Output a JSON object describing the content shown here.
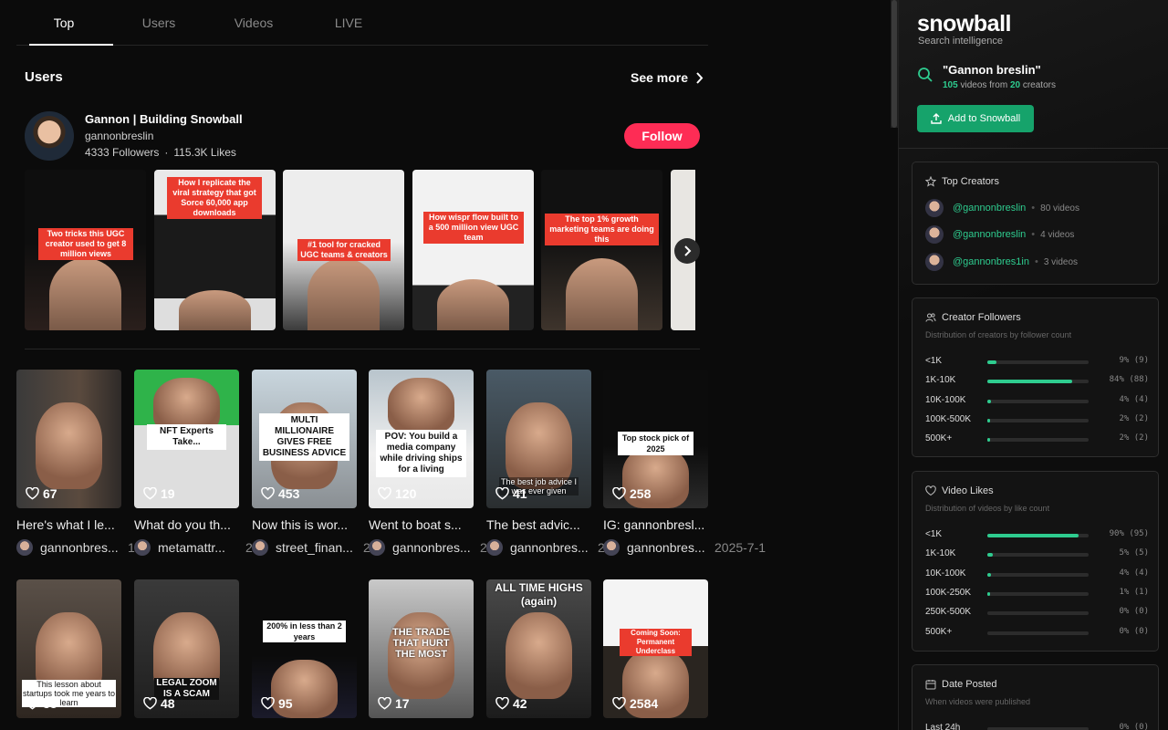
{
  "tabs": [
    "Top",
    "Users",
    "Videos",
    "LIVE"
  ],
  "users_section": {
    "title": "Users",
    "see_more": "See more",
    "user": {
      "name": "Gannon | Building Snowball",
      "handle": "gannonbreslin",
      "followers": "4333 Followers",
      "likes": "115.3K Likes",
      "follow": "Follow"
    },
    "thumb_captions": [
      "Two tricks this UGC creator used to get 8 million views",
      "How I replicate the viral strategy that got Sorce 60,000 app downloads",
      "#1 tool for cracked UGC teams & creators",
      "How wispr flow built to a 500 million view UGC team",
      "The top 1% growth marketing teams are doing this",
      ""
    ]
  },
  "videos_row1": [
    {
      "overlay": "",
      "likes": "67",
      "title": "Here's what I le...",
      "author": "gannonbres...",
      "date": "1"
    },
    {
      "overlay": "NFT Experts Take...",
      "likes": "19",
      "title": "What do you th...",
      "author": "metamattr...",
      "date": "2"
    },
    {
      "overlay": "MULTI MILLIONAIRE GIVES FREE BUSINESS ADVICE",
      "likes": "453",
      "title": "Now this is wor...",
      "author": "street_finan...",
      "date": "2"
    },
    {
      "overlay": "POV: You build a media company while driving ships for a living",
      "likes": "120",
      "title": "Went to boat s...",
      "author": "gannonbres...",
      "date": "2"
    },
    {
      "overlay": "The best job advice I was ever given",
      "likes": "41",
      "title": "The best advic...",
      "author": "gannonbres...",
      "date": "2"
    },
    {
      "overlay": "Top stock pick of 2025",
      "likes": "258",
      "title": "IG: gannonbresl...",
      "author": "gannonbres...",
      "date": "2025-7-1"
    }
  ],
  "videos_row2": [
    {
      "overlay": "This lesson about startups took me years to learn",
      "likes": "38"
    },
    {
      "overlay": "LEGAL ZOOM IS A SCAM",
      "likes": "48"
    },
    {
      "overlay": "200% in less than 2 years",
      "likes": "95"
    },
    {
      "overlay": "THE TRADE THAT HURT THE MOST",
      "likes": "17"
    },
    {
      "overlay": "ALL TIME HIGHS (again)",
      "likes": "42"
    },
    {
      "overlay": "Coming Soon: Permanent Underclass",
      "likes": "2584"
    }
  ],
  "sidebar": {
    "brand": "snowball",
    "brand_sub": "Search intelligence",
    "query": "\"Gannon breslin\"",
    "query_videos": "105",
    "query_mid": "videos from",
    "query_creators": "20",
    "query_end": "creators",
    "add_button": "Add to Snowball",
    "top_creators": {
      "title": "Top Creators",
      "items": [
        {
          "handle": "@gannonbreslin",
          "count": "80 videos"
        },
        {
          "handle": "@gannonbreslin",
          "count": "4 videos"
        },
        {
          "handle": "@gannonbres1in",
          "count": "3 videos"
        }
      ]
    },
    "followers": {
      "title": "Creator Followers",
      "subtitle": "Distribution of creators by follower count",
      "rows": [
        {
          "label": "<1K",
          "value": "9% (9)",
          "pct": 9
        },
        {
          "label": "1K-10K",
          "value": "84% (88)",
          "pct": 84
        },
        {
          "label": "10K-100K",
          "value": "4% (4)",
          "pct": 4
        },
        {
          "label": "100K-500K",
          "value": "2% (2)",
          "pct": 2
        },
        {
          "label": "500K+",
          "value": "2% (2)",
          "pct": 2
        }
      ]
    },
    "likes": {
      "title": "Video Likes",
      "subtitle": "Distribution of videos by like count",
      "rows": [
        {
          "label": "<1K",
          "value": "90% (95)",
          "pct": 90
        },
        {
          "label": "1K-10K",
          "value": "5% (5)",
          "pct": 5
        },
        {
          "label": "10K-100K",
          "value": "4% (4)",
          "pct": 4
        },
        {
          "label": "100K-250K",
          "value": "1% (1)",
          "pct": 1
        },
        {
          "label": "250K-500K",
          "value": "0% (0)",
          "pct": 0
        },
        {
          "label": "500K+",
          "value": "0% (0)",
          "pct": 0
        }
      ]
    },
    "date_posted": {
      "title": "Date Posted",
      "subtitle": "When videos were published",
      "rows": [
        {
          "label": "Last 24h",
          "value": "0% (0)",
          "pct": 0
        }
      ]
    }
  },
  "colors": {
    "accent": "#2ecc8f",
    "follow": "#fe2c55",
    "caption_red": "#ea3b2e"
  },
  "icons": [
    "chevron-right-icon",
    "heart-icon",
    "search-icon",
    "upload-icon",
    "star-icon",
    "users-icon",
    "calendar-icon"
  ]
}
